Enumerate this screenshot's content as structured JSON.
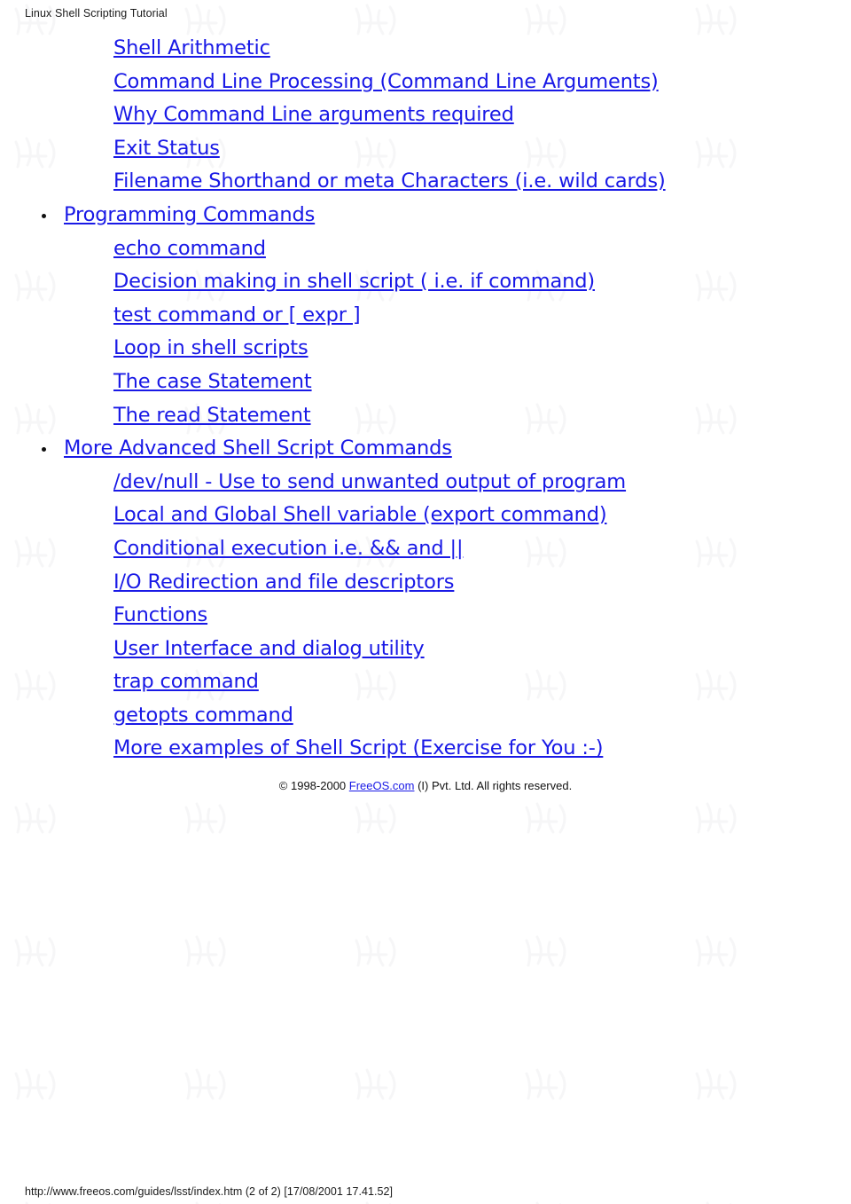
{
  "header": {
    "title": "Linux Shell Scripting Tutorial"
  },
  "toc": {
    "entries": [
      {
        "level": "sub",
        "label": "Shell Arithmetic"
      },
      {
        "level": "sub",
        "label": "Command Line Processing (Command Line Arguments)"
      },
      {
        "level": "sub",
        "label": "Why Command Line arguments required"
      },
      {
        "level": "sub",
        "label": "Exit Status"
      },
      {
        "level": "sub",
        "label": "Filename Shorthand or meta Characters (i.e. wild cards)"
      },
      {
        "level": "top",
        "label": "Programming Commands"
      },
      {
        "level": "sub",
        "label": "echo command"
      },
      {
        "level": "sub",
        "label": "Decision making in shell script ( i.e. if command)"
      },
      {
        "level": "sub",
        "label": "test command or [ expr ]"
      },
      {
        "level": "sub",
        "label": "Loop in shell scripts"
      },
      {
        "level": "sub",
        "label": "The case Statement"
      },
      {
        "level": "sub",
        "label": "The read Statement"
      },
      {
        "level": "top",
        "label": "More Advanced Shell Script Commands"
      },
      {
        "level": "sub",
        "label": "/dev/null - Use to send unwanted output of program"
      },
      {
        "level": "sub",
        "label": "Local and Global Shell variable (export command)"
      },
      {
        "level": "sub",
        "label": "Conditional execution i.e. && and ||"
      },
      {
        "level": "sub",
        "label": "I/O Redirection and file descriptors"
      },
      {
        "level": "sub",
        "label": "Functions"
      },
      {
        "level": "sub",
        "label": "User Interface and dialog utility"
      },
      {
        "level": "sub",
        "label": "trap command"
      },
      {
        "level": "sub",
        "label": "getopts command"
      },
      {
        "level": "sub",
        "label": "More examples of Shell Script (Exercise for You :-)"
      }
    ]
  },
  "copyright": {
    "prefix": "© 1998-2000 ",
    "link": "FreeOS.com",
    "suffix": " (I) Pvt. Ltd. All rights reserved."
  },
  "footer": {
    "text": "http://www.freeos.com/guides/lsst/index.htm (2 of 2) [17/08/2001 17.41.52]"
  },
  "colors": {
    "link": "#1919E6",
    "text": "#000000",
    "background": "#FFFFFF"
  }
}
